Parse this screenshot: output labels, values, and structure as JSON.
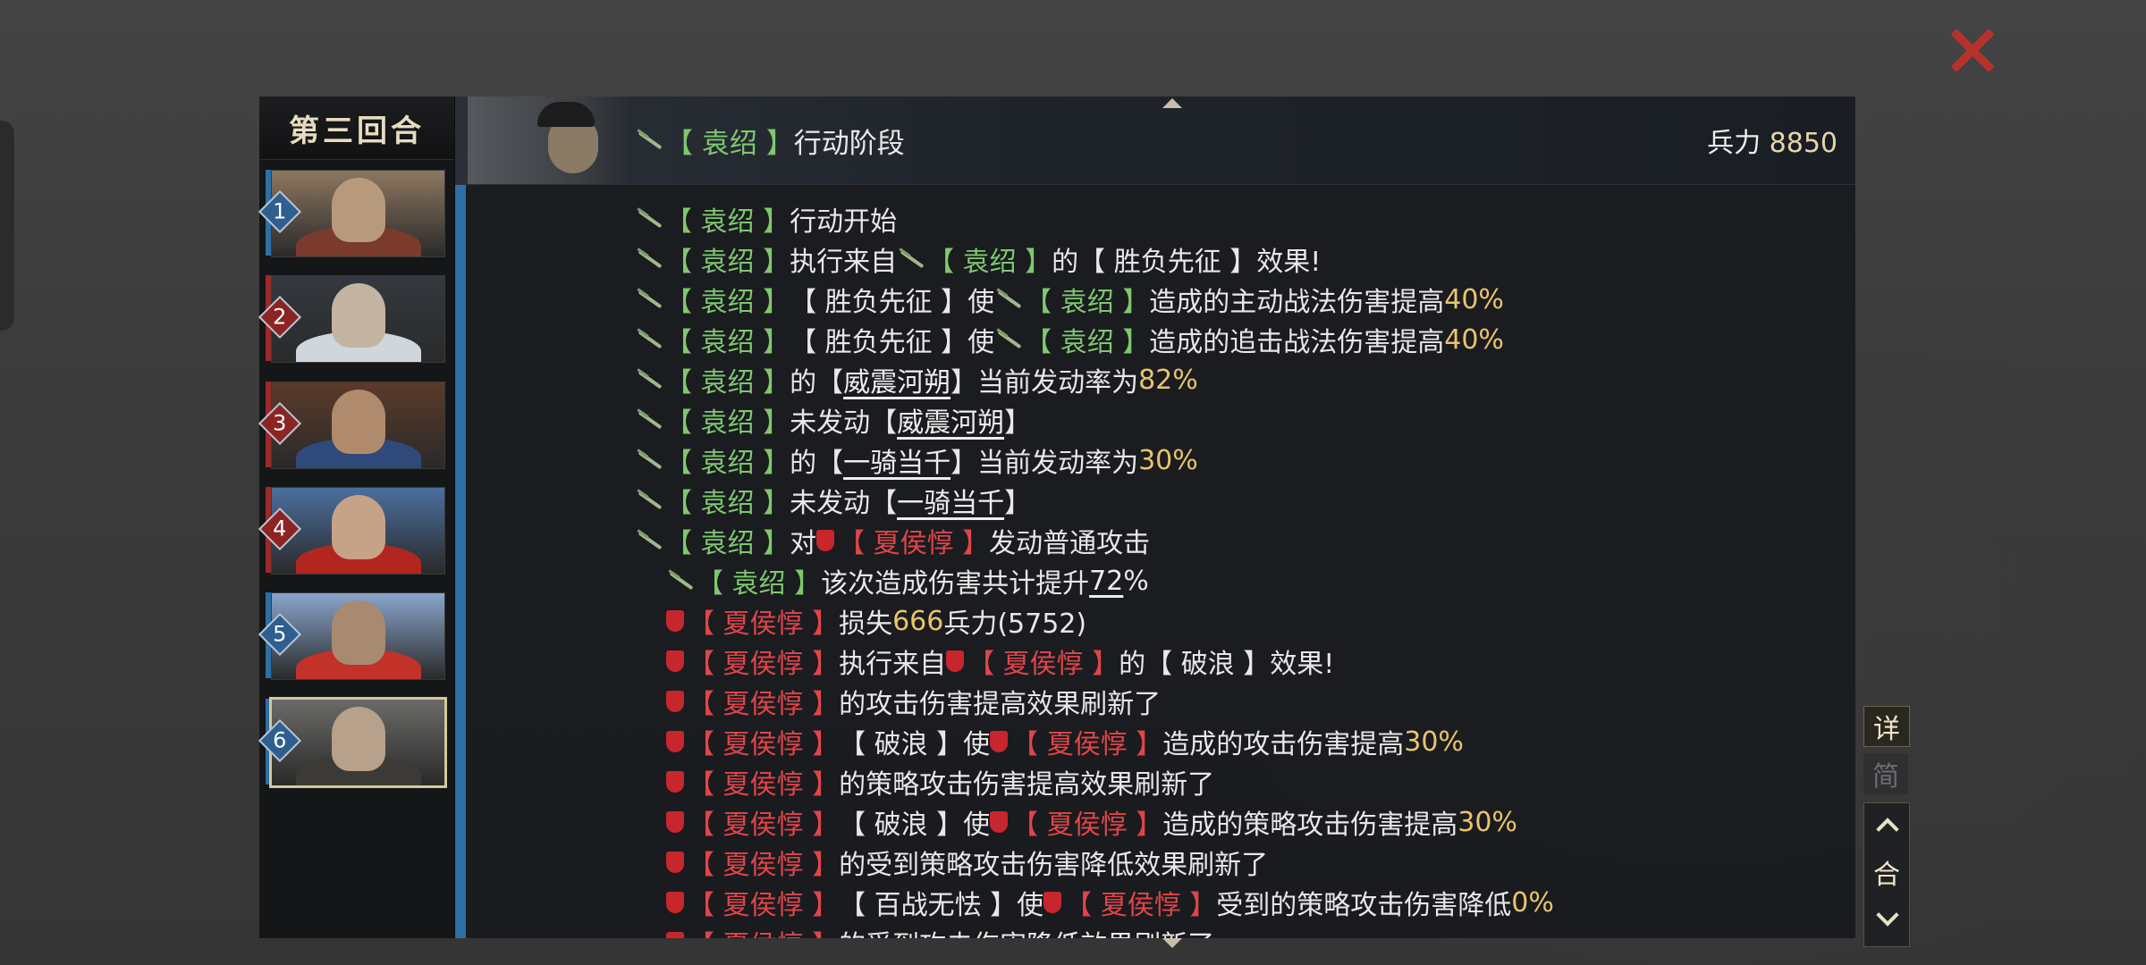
{
  "round_title": "第三回合",
  "header": {
    "name": "袁绍",
    "phase": "行动阶段",
    "troops_label": "兵力",
    "troops_value": "8850"
  },
  "portraits": [
    {
      "num": "1",
      "side": "blue"
    },
    {
      "num": "2",
      "side": "red"
    },
    {
      "num": "3",
      "side": "red"
    },
    {
      "num": "4",
      "side": "red"
    },
    {
      "num": "5",
      "side": "blue"
    },
    {
      "num": "6",
      "side": "blue",
      "selected": true
    }
  ],
  "controls": {
    "detail": "详",
    "simple": "简",
    "round": "合"
  },
  "colors": {
    "ally": "#7fc86e",
    "enemy": "#e0454a",
    "percent": "#e9c46a",
    "accent": "#2d6fa7",
    "close": "#b8322c"
  },
  "log": [
    [
      {
        "t": "sword"
      },
      {
        "t": "n",
        "c": "g",
        "v": "【 袁绍 】"
      },
      {
        "t": "x",
        "v": "行动开始"
      }
    ],
    [
      {
        "t": "sword"
      },
      {
        "t": "n",
        "c": "g",
        "v": "【 袁绍 】"
      },
      {
        "t": "x",
        "v": "执行来自"
      },
      {
        "t": "sword"
      },
      {
        "t": "n",
        "c": "g",
        "v": "【 袁绍 】"
      },
      {
        "t": "x",
        "v": "的【 胜负先征 】效果!"
      }
    ],
    [
      {
        "t": "sword"
      },
      {
        "t": "n",
        "c": "g",
        "v": "【 袁绍 】"
      },
      {
        "t": "x",
        "v": "【 胜负先征 】使"
      },
      {
        "t": "sword"
      },
      {
        "t": "n",
        "c": "g",
        "v": "【 袁绍 】"
      },
      {
        "t": "x",
        "v": "造成的主动战法伤害提高"
      },
      {
        "t": "p",
        "v": "40%"
      }
    ],
    [
      {
        "t": "sword"
      },
      {
        "t": "n",
        "c": "g",
        "v": "【 袁绍 】"
      },
      {
        "t": "x",
        "v": "【 胜负先征 】使"
      },
      {
        "t": "sword"
      },
      {
        "t": "n",
        "c": "g",
        "v": "【 袁绍 】"
      },
      {
        "t": "x",
        "v": "造成的追击战法伤害提高"
      },
      {
        "t": "p",
        "v": "40%"
      }
    ],
    [
      {
        "t": "sword"
      },
      {
        "t": "n",
        "c": "g",
        "v": "【 袁绍 】"
      },
      {
        "t": "x",
        "v": "的【 "
      },
      {
        "t": "s",
        "v": "威震河朔"
      },
      {
        "t": "x",
        "v": " 】当前发动率为"
      },
      {
        "t": "p",
        "v": "82%"
      }
    ],
    [
      {
        "t": "sword"
      },
      {
        "t": "n",
        "c": "g",
        "v": "【 袁绍 】"
      },
      {
        "t": "x",
        "v": "未发动【 "
      },
      {
        "t": "s",
        "v": "威震河朔"
      },
      {
        "t": "x",
        "v": " 】"
      }
    ],
    [
      {
        "t": "sword"
      },
      {
        "t": "n",
        "c": "g",
        "v": "【 袁绍 】"
      },
      {
        "t": "x",
        "v": "的【 "
      },
      {
        "t": "s",
        "v": "一骑当千"
      },
      {
        "t": "x",
        "v": " 】当前发动率为"
      },
      {
        "t": "p",
        "v": "30%"
      }
    ],
    [
      {
        "t": "sword"
      },
      {
        "t": "n",
        "c": "g",
        "v": "【 袁绍 】"
      },
      {
        "t": "x",
        "v": "未发动【 "
      },
      {
        "t": "s",
        "v": "一骑当千"
      },
      {
        "t": "x",
        "v": " 】"
      }
    ],
    [
      {
        "t": "sword"
      },
      {
        "t": "n",
        "c": "g",
        "v": "【 袁绍 】"
      },
      {
        "t": "x",
        "v": "对"
      },
      {
        "t": "shield"
      },
      {
        "t": "n",
        "c": "r",
        "v": "【 夏侯惇 】"
      },
      {
        "t": "x",
        "v": "发动普通攻击"
      }
    ],
    [
      {
        "t": "sword"
      },
      {
        "t": "n",
        "c": "g",
        "v": "【 袁绍 】"
      },
      {
        "t": "x",
        "v": "该次造成伤害共计提升"
      },
      {
        "t": "ps",
        "v": "72"
      },
      {
        "t": "x",
        "v": "%"
      }
    ],
    [
      {
        "t": "shield"
      },
      {
        "t": "n",
        "c": "r",
        "v": "【 夏侯惇 】"
      },
      {
        "t": "x",
        "v": "损失"
      },
      {
        "t": "p",
        "v": "666"
      },
      {
        "t": "x",
        "v": "兵力(5752)"
      }
    ],
    [
      {
        "t": "shield"
      },
      {
        "t": "n",
        "c": "r",
        "v": "【 夏侯惇 】"
      },
      {
        "t": "x",
        "v": "执行来自"
      },
      {
        "t": "shield"
      },
      {
        "t": "n",
        "c": "r",
        "v": "【 夏侯惇 】"
      },
      {
        "t": "x",
        "v": "的【 破浪 】效果!"
      }
    ],
    [
      {
        "t": "shield"
      },
      {
        "t": "n",
        "c": "r",
        "v": "【 夏侯惇 】"
      },
      {
        "t": "x",
        "v": "的攻击伤害提高效果刷新了"
      }
    ],
    [
      {
        "t": "shield"
      },
      {
        "t": "n",
        "c": "r",
        "v": "【 夏侯惇 】"
      },
      {
        "t": "x",
        "v": "【 破浪 】使"
      },
      {
        "t": "shield"
      },
      {
        "t": "n",
        "c": "r",
        "v": "【 夏侯惇 】"
      },
      {
        "t": "x",
        "v": "造成的攻击伤害提高"
      },
      {
        "t": "p",
        "v": "30%"
      }
    ],
    [
      {
        "t": "shield"
      },
      {
        "t": "n",
        "c": "r",
        "v": "【 夏侯惇 】"
      },
      {
        "t": "x",
        "v": "的策略攻击伤害提高效果刷新了"
      }
    ],
    [
      {
        "t": "shield"
      },
      {
        "t": "n",
        "c": "r",
        "v": "【 夏侯惇 】"
      },
      {
        "t": "x",
        "v": "【 破浪 】使"
      },
      {
        "t": "shield"
      },
      {
        "t": "n",
        "c": "r",
        "v": "【 夏侯惇 】"
      },
      {
        "t": "x",
        "v": "造成的策略攻击伤害提高"
      },
      {
        "t": "p",
        "v": "30%"
      }
    ],
    [
      {
        "t": "shield"
      },
      {
        "t": "n",
        "c": "r",
        "v": "【 夏侯惇 】"
      },
      {
        "t": "x",
        "v": "的受到策略攻击伤害降低效果刷新了"
      }
    ],
    [
      {
        "t": "shield"
      },
      {
        "t": "n",
        "c": "r",
        "v": "【 夏侯惇 】"
      },
      {
        "t": "x",
        "v": "【 百战无怯 】使"
      },
      {
        "t": "shield"
      },
      {
        "t": "n",
        "c": "r",
        "v": "【 夏侯惇 】"
      },
      {
        "t": "x",
        "v": "受到的策略攻击伤害降低"
      },
      {
        "t": "p",
        "v": "0%"
      }
    ],
    [
      {
        "t": "shield"
      },
      {
        "t": "n",
        "c": "r",
        "v": "【 夏侯惇 】"
      },
      {
        "t": "x",
        "v": "的受到攻击伤害降低效果刷新了"
      }
    ]
  ]
}
